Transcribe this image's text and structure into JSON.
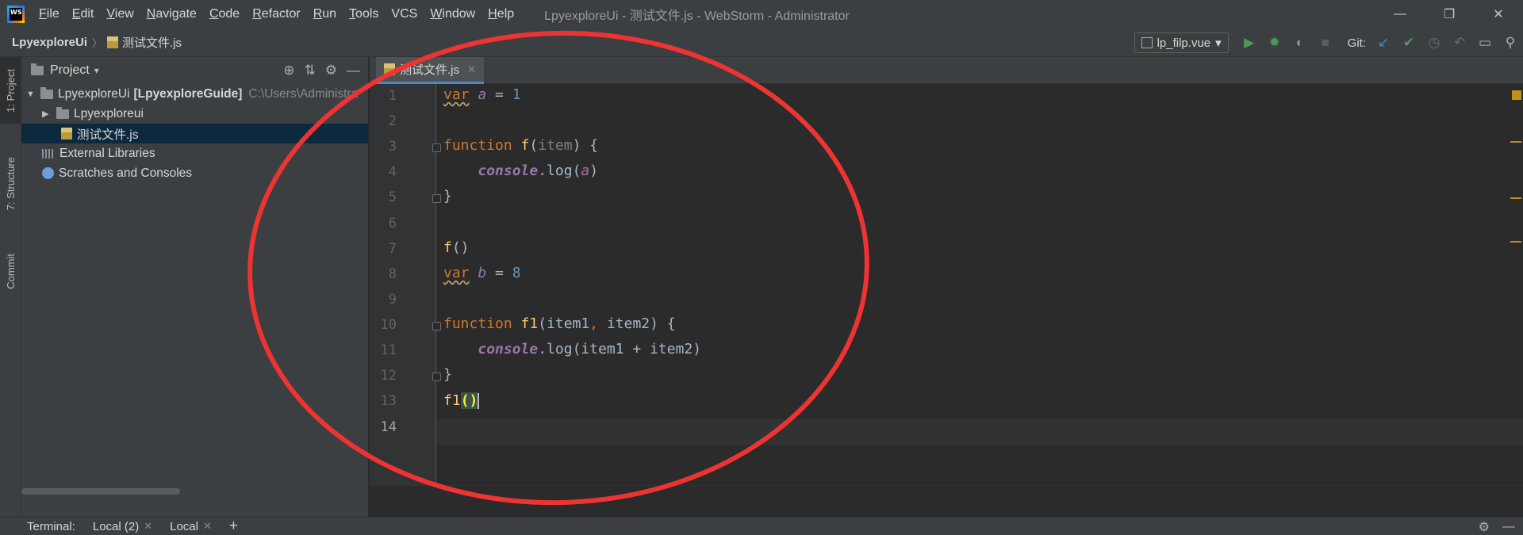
{
  "titlebar": {
    "logo_text": "WS",
    "menu": [
      {
        "label": "File",
        "mnemonic": "F",
        "rest": "ile"
      },
      {
        "label": "Edit",
        "mnemonic": "E",
        "rest": "dit"
      },
      {
        "label": "View",
        "mnemonic": "V",
        "rest": "iew"
      },
      {
        "label": "Navigate",
        "mnemonic": "N",
        "rest": "avigate"
      },
      {
        "label": "Code",
        "mnemonic": "C",
        "rest": "ode"
      },
      {
        "label": "Refactor",
        "mnemonic": "R",
        "rest": "efactor"
      },
      {
        "label": "Run",
        "mnemonic": "R",
        "rest": "un"
      },
      {
        "label": "Tools",
        "mnemonic": "T",
        "rest": "ools"
      },
      {
        "label": "VCS",
        "mnemonic": "",
        "rest": "VCS"
      },
      {
        "label": "Window",
        "mnemonic": "W",
        "rest": "indow"
      },
      {
        "label": "Help",
        "mnemonic": "H",
        "rest": "elp"
      }
    ],
    "window_title": "LpyexploreUi - 测试文件.js - WebStorm - Administrator",
    "controls": {
      "minimize": "—",
      "restore": "❐",
      "close": "✕"
    }
  },
  "navbar": {
    "root": "LpyexploreUi",
    "separator": "〉",
    "file": "测试文件.js",
    "run_config": "lp_filp.vue",
    "git_label": "Git:"
  },
  "left_strip": {
    "project": "1: Project",
    "structure": "7: Structure",
    "commit": "Commit"
  },
  "project": {
    "title": "Project",
    "tree": [
      {
        "label": "LpyexploreUi",
        "bold_suffix": "[LpyexploreGuide]",
        "path": "C:\\Users\\Administra"
      },
      {
        "label": "Lpyexploreui"
      },
      {
        "label": "测试文件.js"
      },
      {
        "label": "External Libraries"
      },
      {
        "label": "Scratches and Consoles"
      }
    ]
  },
  "editor": {
    "tab_label": "测试文件.js",
    "tab_close": "✕",
    "line_numbers": [
      "1",
      "2",
      "3",
      "4",
      "5",
      "6",
      "7",
      "8",
      "9",
      "10",
      "11",
      "12",
      "13",
      "14"
    ],
    "code": {
      "l1_kw": "var",
      "l1_var": "a",
      "l1_op": " = ",
      "l1_num": "1",
      "l3_kw": "function",
      "l3_fn": "f",
      "l3_open": "(",
      "l3_param": "item",
      "l3_close": ") {",
      "l4_indent": "    ",
      "l4_console": "console",
      "l4_log": ".log(",
      "l4_arg": "a",
      "l4_end": ")",
      "l5": "}",
      "l7_fn": "f",
      "l7_call": "()",
      "l8_kw": "var",
      "l8_var": "b",
      "l8_op": " = ",
      "l8_num": "8",
      "l10_kw": "function",
      "l10_fn": "f1",
      "l10_open": "(item1",
      "l10_comma": ",",
      "l10_rest": " item2) {",
      "l11_indent": "    ",
      "l11_console": "console",
      "l11_log": ".log(item1 + item2)",
      "l12": "}",
      "l14_fn": "f1",
      "l14_call": "()"
    }
  },
  "terminal": {
    "label": "Terminal:",
    "tabs": [
      "Local (2)",
      "Local"
    ],
    "tab_close": "✕",
    "add": "+"
  },
  "colors": {
    "annotation": "#ee3333",
    "keyword": "#cc7832",
    "function": "#ffc66d",
    "number": "#6897bb",
    "variable": "#9876aa",
    "selection": "#0d293e"
  }
}
